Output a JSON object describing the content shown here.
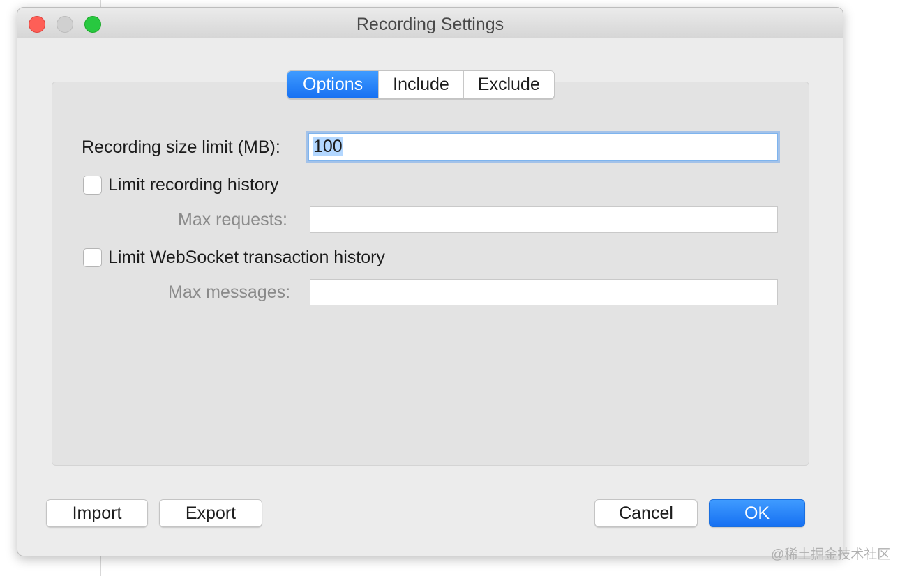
{
  "window": {
    "title": "Recording Settings"
  },
  "tabs": [
    {
      "label": "Options",
      "active": true
    },
    {
      "label": "Include",
      "active": false
    },
    {
      "label": "Exclude",
      "active": false
    }
  ],
  "options": {
    "size_limit_label": "Recording size limit (MB):",
    "size_limit_value": "100",
    "limit_history_label": "Limit recording history",
    "limit_history_checked": false,
    "max_requests_label": "Max requests:",
    "max_requests_value": "",
    "limit_ws_label": "Limit WebSocket transaction history",
    "limit_ws_checked": false,
    "max_messages_label": "Max messages:",
    "max_messages_value": ""
  },
  "buttons": {
    "import": "Import",
    "export": "Export",
    "cancel": "Cancel",
    "ok": "OK"
  },
  "watermark": "@稀土掘金技术社区",
  "colors": {
    "accent": "#1670f2",
    "close": "#fe5f57",
    "zoom": "#28c840"
  }
}
